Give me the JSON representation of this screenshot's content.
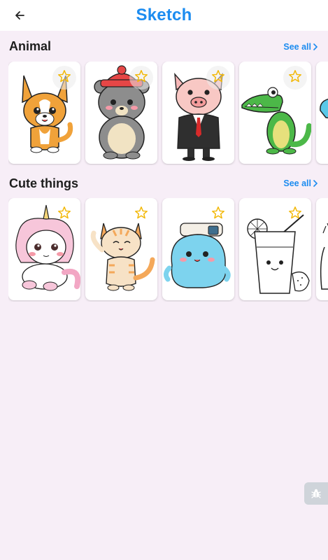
{
  "header": {
    "title": "Sketch",
    "back_icon": "arrow-left-icon"
  },
  "colors": {
    "accent": "#1c8cf0",
    "background": "#f7eef7",
    "star": "#f2b705",
    "text": "#1d1d1d"
  },
  "sections": [
    {
      "title": "Animal",
      "see_all": "See all",
      "items": [
        {
          "subject": "chihuahua dog"
        },
        {
          "subject": "bear with red hat"
        },
        {
          "subject": "pig in suit"
        },
        {
          "subject": "crocodile"
        },
        {
          "subject": "blue whale"
        }
      ]
    },
    {
      "title": "Cute things",
      "see_all": "See all",
      "items": [
        {
          "subject": "unicorn"
        },
        {
          "subject": "orange cat"
        },
        {
          "subject": "blue seal with camera"
        },
        {
          "subject": "lemonade glass"
        },
        {
          "subject": "bottle"
        }
      ]
    }
  ],
  "debug_button": {
    "icon": "bug-icon"
  }
}
